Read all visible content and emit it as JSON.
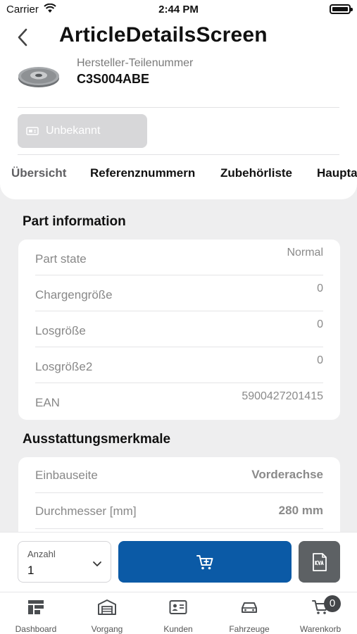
{
  "status_bar": {
    "carrier": "Carrier",
    "time": "2:44 PM"
  },
  "header": {
    "title": "ArticleDetailsScreen",
    "part_number_label": "Hersteller-Teilenummer",
    "part_number": "C3S004ABE",
    "availability": "Unbekannt"
  },
  "tabs": [
    {
      "label": "Übersicht"
    },
    {
      "label": "Referenznummern"
    },
    {
      "label": "Zubehörliste"
    },
    {
      "label": "Hauptartikel"
    }
  ],
  "part_information": {
    "title": "Part information",
    "rows": [
      {
        "label": "Part state",
        "value": "Normal"
      },
      {
        "label": "Chargengröße",
        "value": "0"
      },
      {
        "label": "Losgröße",
        "value": "0"
      },
      {
        "label": "Losgröße2",
        "value": "0"
      },
      {
        "label": "EAN",
        "value": "5900427201415"
      }
    ]
  },
  "features": {
    "title": "Ausstattungsmerkmale",
    "rows": [
      {
        "label": "Einbauseite",
        "value": "Vorderachse"
      },
      {
        "label": "Durchmesser [mm]",
        "value": "280 mm"
      }
    ]
  },
  "action_bar": {
    "quantity_label": "Anzahl",
    "quantity_value": "1"
  },
  "tabbar": {
    "items": [
      {
        "label": "Dashboard",
        "icon": "dashboard-icon"
      },
      {
        "label": "Vorgang",
        "icon": "garage-icon"
      },
      {
        "label": "Kunden",
        "icon": "customer-card-icon"
      },
      {
        "label": "Fahrzeuge",
        "icon": "car-icon"
      },
      {
        "label": "Warenkorb",
        "icon": "cart-icon"
      }
    ],
    "cart_count": "0"
  },
  "colors": {
    "primary": "#0b5aa6",
    "secondary_button": "#5d6164",
    "background": "#eeeeef"
  }
}
